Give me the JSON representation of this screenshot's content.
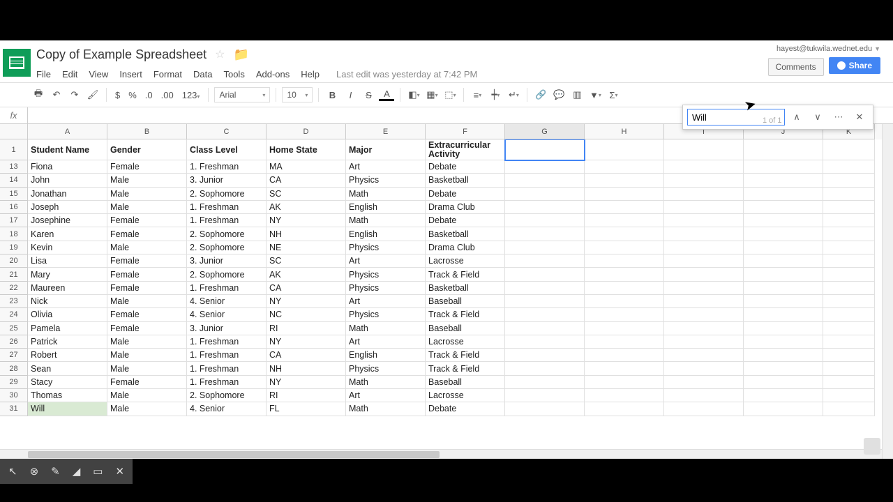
{
  "account": "hayest@tukwila.wednet.edu",
  "title": "Copy of Example Spreadsheet",
  "last_edit": "Last edit was yesterday at 7:42 PM",
  "comments_label": "Comments",
  "share_label": "Share",
  "menus": [
    "File",
    "Edit",
    "View",
    "Insert",
    "Format",
    "Data",
    "Tools",
    "Add-ons",
    "Help"
  ],
  "font": "Arial",
  "font_size": "10",
  "fx_label": "fx",
  "find": {
    "value": "Will",
    "count": "1 of 1"
  },
  "col_letters": [
    "A",
    "B",
    "C",
    "D",
    "E",
    "F",
    "G",
    "H",
    "I",
    "J",
    "K"
  ],
  "selected_col_index": 6,
  "headers_row_num": "1",
  "headers": [
    "Student Name",
    "Gender",
    "Class Level",
    "Home State",
    "Major",
    "Extracurricular Activity",
    "",
    "",
    "",
    "",
    ""
  ],
  "rows": [
    {
      "n": "13",
      "c": [
        "Fiona",
        "Female",
        "1. Freshman",
        "MA",
        "Art",
        "Debate",
        "",
        "",
        "",
        "",
        ""
      ]
    },
    {
      "n": "14",
      "c": [
        "John",
        "Male",
        "3. Junior",
        "CA",
        "Physics",
        "Basketball",
        "",
        "",
        "",
        "",
        ""
      ]
    },
    {
      "n": "15",
      "c": [
        "Jonathan",
        "Male",
        "2. Sophomore",
        "SC",
        "Math",
        "Debate",
        "",
        "",
        "",
        "",
        ""
      ]
    },
    {
      "n": "16",
      "c": [
        "Joseph",
        "Male",
        "1. Freshman",
        "AK",
        "English",
        "Drama Club",
        "",
        "",
        "",
        "",
        ""
      ]
    },
    {
      "n": "17",
      "c": [
        "Josephine",
        "Female",
        "1. Freshman",
        "NY",
        "Math",
        "Debate",
        "",
        "",
        "",
        "",
        ""
      ]
    },
    {
      "n": "18",
      "c": [
        "Karen",
        "Female",
        "2. Sophomore",
        "NH",
        "English",
        "Basketball",
        "",
        "",
        "",
        "",
        ""
      ]
    },
    {
      "n": "19",
      "c": [
        "Kevin",
        "Male",
        "2. Sophomore",
        "NE",
        "Physics",
        "Drama Club",
        "",
        "",
        "",
        "",
        ""
      ]
    },
    {
      "n": "20",
      "c": [
        "Lisa",
        "Female",
        "3. Junior",
        "SC",
        "Art",
        "Lacrosse",
        "",
        "",
        "",
        "",
        ""
      ]
    },
    {
      "n": "21",
      "c": [
        "Mary",
        "Female",
        "2. Sophomore",
        "AK",
        "Physics",
        "Track & Field",
        "",
        "",
        "",
        "",
        ""
      ]
    },
    {
      "n": "22",
      "c": [
        "Maureen",
        "Female",
        "1. Freshman",
        "CA",
        "Physics",
        "Basketball",
        "",
        "",
        "",
        "",
        ""
      ]
    },
    {
      "n": "23",
      "c": [
        "Nick",
        "Male",
        "4. Senior",
        "NY",
        "Art",
        "Baseball",
        "",
        "",
        "",
        "",
        ""
      ]
    },
    {
      "n": "24",
      "c": [
        "Olivia",
        "Female",
        "4. Senior",
        "NC",
        "Physics",
        "Track & Field",
        "",
        "",
        "",
        "",
        ""
      ]
    },
    {
      "n": "25",
      "c": [
        "Pamela",
        "Female",
        "3. Junior",
        "RI",
        "Math",
        "Baseball",
        "",
        "",
        "",
        "",
        ""
      ]
    },
    {
      "n": "26",
      "c": [
        "Patrick",
        "Male",
        "1. Freshman",
        "NY",
        "Art",
        "Lacrosse",
        "",
        "",
        "",
        "",
        ""
      ]
    },
    {
      "n": "27",
      "c": [
        "Robert",
        "Male",
        "1. Freshman",
        "CA",
        "English",
        "Track & Field",
        "",
        "",
        "",
        "",
        ""
      ]
    },
    {
      "n": "28",
      "c": [
        "Sean",
        "Male",
        "1. Freshman",
        "NH",
        "Physics",
        "Track & Field",
        "",
        "",
        "",
        "",
        ""
      ]
    },
    {
      "n": "29",
      "c": [
        "Stacy",
        "Female",
        "1. Freshman",
        "NY",
        "Math",
        "Baseball",
        "",
        "",
        "",
        "",
        ""
      ]
    },
    {
      "n": "30",
      "c": [
        "Thomas",
        "Male",
        "2. Sophomore",
        "RI",
        "Art",
        "Lacrosse",
        "",
        "",
        "",
        "",
        ""
      ]
    },
    {
      "n": "31",
      "c": [
        "Will",
        "Male",
        "4. Senior",
        "FL",
        "Math",
        "Debate",
        "",
        "",
        "",
        "",
        ""
      ],
      "hl": true
    }
  ]
}
